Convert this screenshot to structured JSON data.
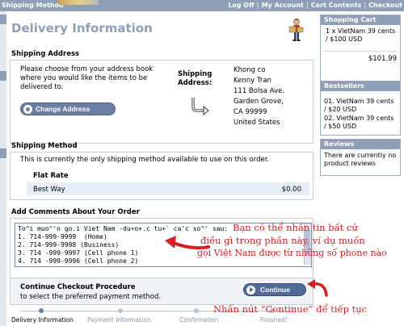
{
  "topbar": {
    "left_text": "Shipping Method",
    "links": [
      "Log Off",
      "My Account",
      "Cart Contents",
      "Checkout"
    ]
  },
  "page": {
    "title": "Delivery Information"
  },
  "shipping_address": {
    "title": "Shipping Address",
    "instructions": "Please choose from your address book where you would like the items to be delivered to.",
    "change_button": "Change Address",
    "label_line1": "Shipping",
    "label_line2": "Address:",
    "address_lines": [
      "Khong co",
      "Kenny Tran",
      "111 Bolsa Ave.",
      "Garden Grove,",
      "CA 99999",
      "United States"
    ]
  },
  "shipping_method": {
    "title": "Shipping Method",
    "description": "This is currently the only shipping method available to use on this order.",
    "method_name": "Flat Rate",
    "option_name": "Best Way",
    "option_price": "$0.00"
  },
  "comments": {
    "title": "Add Comments About Your Order",
    "lines": [
      "To^i muo^'n go.i Viet Nam -du+o+.c tu+` ca'c so^' sau:",
      "1. 714-999-9999  (Home)",
      "2. 714-999-9998 (Business)",
      "3. 714 -999-9997 (Cell phone 1)",
      "4. 714 -999-9996 (Cell phone 2)"
    ]
  },
  "continue": {
    "title": "Continue Checkout Procedure",
    "description": "to select the preferred payment method.",
    "button": "Continue"
  },
  "progress": {
    "steps": [
      "Delivery Information",
      "Payment Information",
      "Confirmation",
      "Finished!"
    ],
    "active_index": 0
  },
  "annotations": {
    "comment_note": [
      "Bạn có thể nhắn tin bất cứ",
      "điều gì trong phần này, ví dụ muốn",
      "gọi Việt Nam được từ những số phone nào"
    ],
    "continue_note": "Nhấn nút “Continue” để tiếp tục",
    "color": "#d92020"
  },
  "sidebar": {
    "cart": {
      "title": "Shopping Cart",
      "item": "1 x VietNam 39 cents / $100 USD",
      "total": "$101.99"
    },
    "bestsellers": {
      "title": "Bestsellers",
      "items": [
        "01. VietNam 39 cents / $20 USD",
        "02. VietNam 39 cents / $50 USD"
      ]
    },
    "reviews": {
      "title": "Reviews",
      "text": "There are currently no product reviews"
    }
  },
  "colors": {
    "header_bar": "#8f9fb7",
    "accent_text": "#8f9fb7",
    "button": "#4f6b96"
  },
  "icons": {
    "delivery": "delivery-man-icon",
    "ship_arrow": "curved-arrow-icon"
  }
}
